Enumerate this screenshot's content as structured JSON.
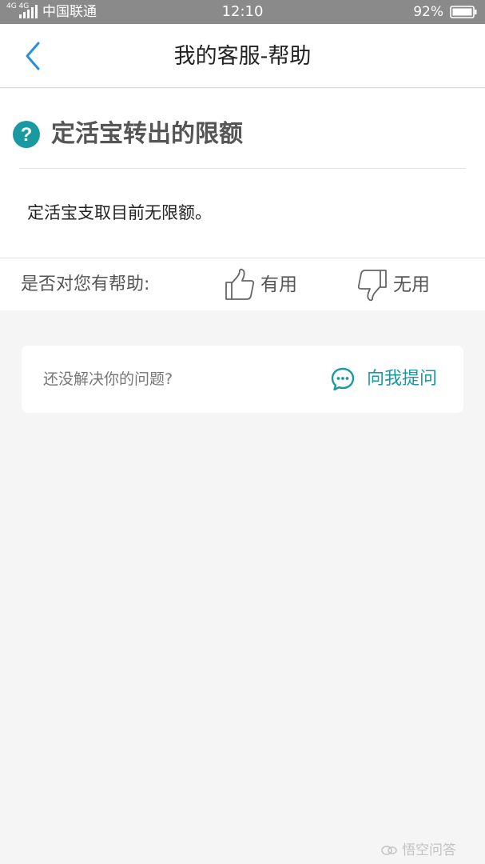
{
  "status_bar": {
    "network": "4G 4G",
    "carrier": "中国联通",
    "time": "12:10",
    "battery": "92%"
  },
  "nav": {
    "title": "我的客服-帮助",
    "back_icon": "chevron-left-icon"
  },
  "article": {
    "icon": "question-circle-icon",
    "title": "定活宝转出的限额",
    "answer": "定活宝支取目前无限额。"
  },
  "feedback": {
    "prompt": "是否对您有帮助:",
    "useful_label": "有用",
    "useless_label": "无用"
  },
  "ask": {
    "prompt": "还没解决你的问题?",
    "button_label": "向我提问"
  },
  "watermark": {
    "text": "悟空问答"
  },
  "colors": {
    "accent": "#1a9aa0",
    "back_arrow": "#2a8fd8",
    "status_bar": "#8a8a8a",
    "background": "#f5f5f5"
  }
}
